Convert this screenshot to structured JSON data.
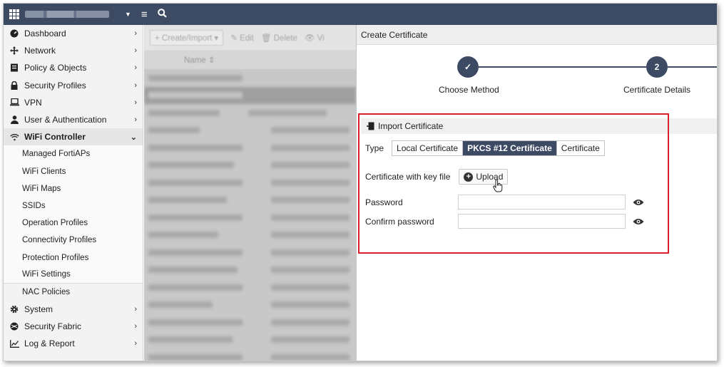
{
  "topbar": {
    "logo_icon": "fortinet-logo-icon",
    "hostname_masked": true,
    "menu_icon": "hamburger-icon",
    "search_icon": "search-icon"
  },
  "sidebar": {
    "items": [
      {
        "label": "Dashboard",
        "icon": "dashboard-icon",
        "arrow": "›"
      },
      {
        "label": "Network",
        "icon": "network-icon",
        "arrow": "›"
      },
      {
        "label": "Policy & Objects",
        "icon": "policy-icon",
        "arrow": "›"
      },
      {
        "label": "Security Profiles",
        "icon": "lock-icon",
        "arrow": "›"
      },
      {
        "label": "VPN",
        "icon": "laptop-icon",
        "arrow": "›"
      },
      {
        "label": "User & Authentication",
        "icon": "user-icon",
        "arrow": "›"
      },
      {
        "label": "WiFi Controller",
        "icon": "wifi-icon",
        "arrow": "⌄"
      }
    ],
    "subitems": [
      "Managed FortiAPs",
      "WiFi Clients",
      "WiFi Maps",
      "SSIDs",
      "Operation Profiles",
      "Connectivity Profiles",
      "Protection Profiles",
      "WiFi Settings",
      "NAC Policies"
    ],
    "bottom_items": [
      {
        "label": "System",
        "icon": "gear-icon",
        "arrow": "›"
      },
      {
        "label": "Security Fabric",
        "icon": "fabric-icon",
        "arrow": "›"
      },
      {
        "label": "Log & Report",
        "icon": "chart-icon",
        "arrow": "›"
      }
    ]
  },
  "middle": {
    "toolbar": {
      "create_label": "+ Create/Import ▾",
      "edit_label": "✎ Edit",
      "delete_label": "🗑 Delete",
      "view_label": "👁 Vi"
    },
    "column_header": "Name ⇕"
  },
  "panel": {
    "title": "Create Certificate",
    "steps": [
      {
        "label": "Choose Method",
        "marker": "✓"
      },
      {
        "label": "Certificate Details",
        "marker": "2"
      }
    ],
    "section_title": "Import Certificate",
    "type_label": "Type",
    "type_options": [
      "Local Certificate",
      "PKCS #12 Certificate",
      "Certificate"
    ],
    "type_selected": "PKCS #12 Certificate",
    "file_label": "Certificate with key file",
    "upload_label": "Upload",
    "password_label": "Password",
    "confirm_password_label": "Confirm password",
    "password_value": "",
    "confirm_password_value": ""
  },
  "colors": {
    "topbar": "#3c4a63",
    "accent": "#3c4a63",
    "highlight": "#d8222a"
  }
}
